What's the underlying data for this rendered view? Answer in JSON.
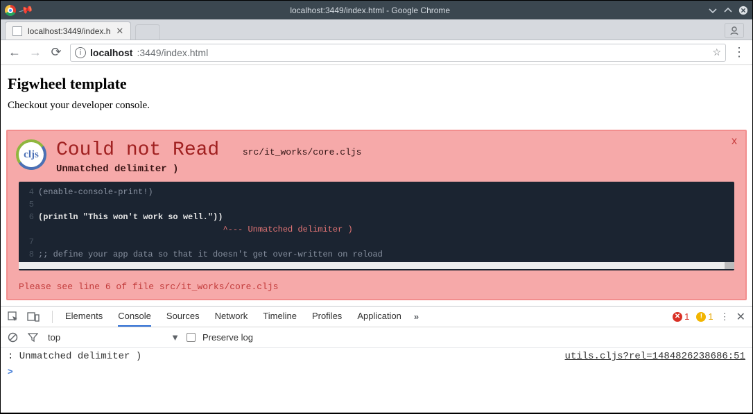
{
  "window": {
    "title": "localhost:3449/index.html - Google Chrome"
  },
  "tab": {
    "title": "localhost:3449/index.h"
  },
  "url": {
    "host": "localhost",
    "rest": ":3449/index.html"
  },
  "page": {
    "heading": "Figwheel template",
    "subtext": "Checkout your developer console."
  },
  "figwheel": {
    "title": "Could not Read",
    "file": "src/it_works/core.cljs",
    "subtitle": "Unmatched delimiter )",
    "code": [
      {
        "n": "4",
        "text": "(enable-console-print!)",
        "hl": false
      },
      {
        "n": "5",
        "text": "",
        "hl": false
      },
      {
        "n": "6",
        "text": "(println \"This won't work so well.\"))",
        "hl": true
      },
      {
        "n": "",
        "text": "                                     ^--- Unmatched delimiter )",
        "err": true
      },
      {
        "n": "7",
        "text": "",
        "hl": false
      },
      {
        "n": "8",
        "text": ";; define your app data so that it doesn't get over-written on reload",
        "hl": false
      }
    ],
    "footer": "Please see line 6 of file src/it_works/core.cljs"
  },
  "devtools": {
    "tabs": [
      "Elements",
      "Console",
      "Sources",
      "Network",
      "Timeline",
      "Profiles",
      "Application"
    ],
    "active_tab": "Console",
    "errors": "1",
    "warnings": "1",
    "context": "top",
    "preserve_label": "Preserve log",
    "log_message": ": Unmatched delimiter )",
    "log_source": "utils.cljs?rel=1484826238686:51",
    "prompt": ">"
  }
}
